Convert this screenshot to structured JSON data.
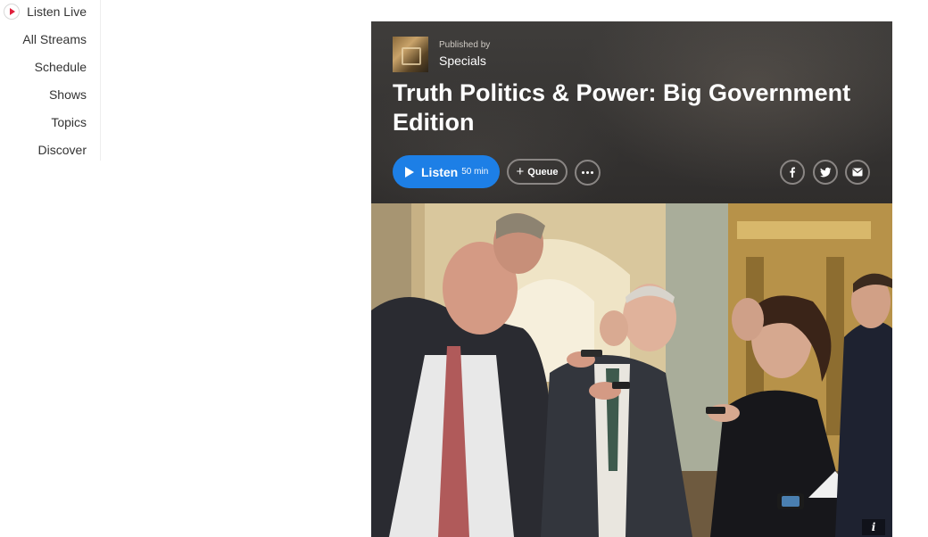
{
  "nav": {
    "items": [
      {
        "label": "Listen Live"
      },
      {
        "label": "All Streams"
      },
      {
        "label": "Schedule"
      },
      {
        "label": "Shows"
      },
      {
        "label": "Topics"
      },
      {
        "label": "Discover"
      }
    ]
  },
  "episode": {
    "published_by_label": "Published by",
    "publisher": "Specials",
    "title": "Truth Politics & Power: Big Government Edition",
    "listen_label": "Listen",
    "duration": "50 min",
    "queue_label": "Queue",
    "info_label": "i"
  },
  "colors": {
    "accent": "#1d7fe6",
    "live_red": "#e0203c"
  }
}
